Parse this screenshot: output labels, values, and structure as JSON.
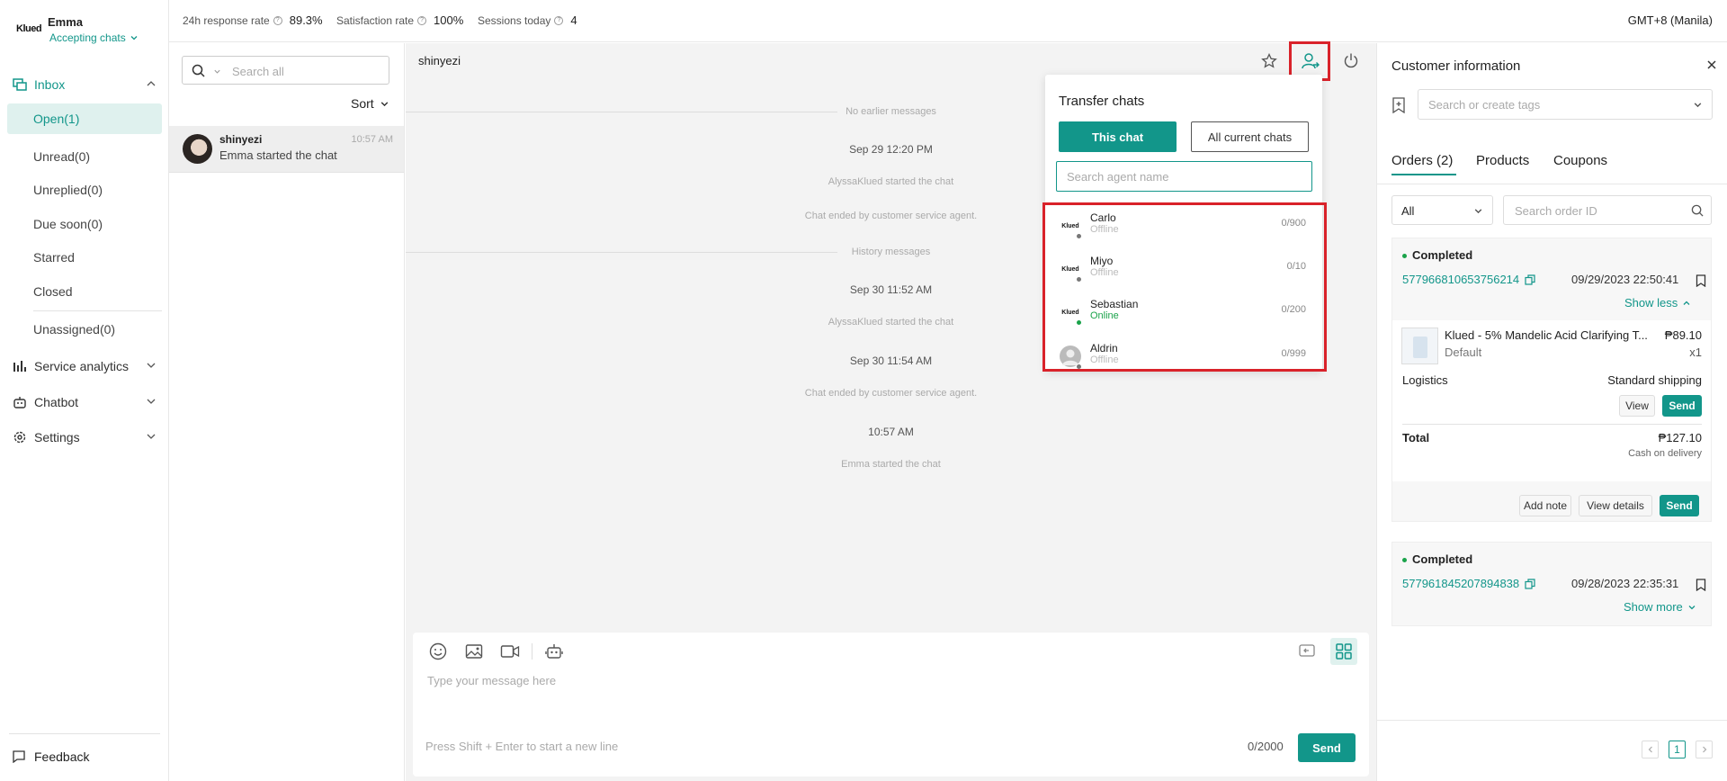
{
  "sidebar": {
    "brand": "Klued",
    "agent_name": "Emma",
    "agent_status": "Accepting chats",
    "inbox_label": "Inbox",
    "items": [
      {
        "label": "Open(1)"
      },
      {
        "label": "Unread(0)"
      },
      {
        "label": "Unreplied(0)"
      },
      {
        "label": "Due soon(0)"
      },
      {
        "label": "Starred"
      },
      {
        "label": "Closed"
      },
      {
        "label": "Unassigned(0)"
      }
    ],
    "groups": [
      {
        "label": "Service analytics"
      },
      {
        "label": "Chatbot"
      },
      {
        "label": "Settings"
      }
    ],
    "feedback": "Feedback"
  },
  "topbar": {
    "response_rate_label": "24h response rate",
    "response_rate_value": "89.3%",
    "satisfaction_label": "Satisfaction rate",
    "satisfaction_value": "100%",
    "sessions_label": "Sessions today",
    "sessions_value": "4",
    "timezone": "GMT+8 (Manila)"
  },
  "convlist": {
    "search_placeholder": "Search all",
    "sort_label": "Sort",
    "conversations": [
      {
        "name": "shinyezi",
        "time": "10:57 AM",
        "preview": "Emma started the chat"
      }
    ]
  },
  "chat": {
    "title": "shinyezi",
    "messages": {
      "no_earlier": "No earlier messages",
      "date1": "Sep 29 12:20 PM",
      "sys1": "AlyssaKlued started the chat",
      "sys2": "Chat ended by customer service agent.",
      "history": "History messages",
      "date2": "Sep 30 11:52 AM",
      "sys3": "AlyssaKlued started the chat",
      "date3": "Sep 30 11:54 AM",
      "sys4": "Chat ended by customer service agent.",
      "date4": "10:57 AM",
      "sys5": "Emma started the chat"
    },
    "composer": {
      "placeholder": "Type your message here",
      "hint": "Press Shift + Enter to start a new line",
      "counter": "0/2000",
      "send": "Send"
    }
  },
  "transfer": {
    "title": "Transfer chats",
    "tab_this": "This chat",
    "tab_all": "All current chats",
    "search_placeholder": "Search agent name",
    "agents": [
      {
        "name": "Carlo",
        "status": "Offline",
        "capacity": "0/900",
        "avatar": "Klued"
      },
      {
        "name": "Miyo",
        "status": "Offline",
        "capacity": "0/10",
        "avatar": "Klued"
      },
      {
        "name": "Sebastian",
        "status": "Online",
        "capacity": "0/200",
        "avatar": "Klued"
      },
      {
        "name": "Aldrin",
        "status": "Offline",
        "capacity": "0/999",
        "avatar": ""
      }
    ]
  },
  "customer": {
    "title": "Customer information",
    "tags_placeholder": "Search or create tags",
    "tabs": [
      "Orders (2)",
      "Products",
      "Coupons"
    ],
    "filter_value": "All",
    "order_search_placeholder": "Search order ID",
    "orders": [
      {
        "status": "Completed",
        "id": "577966810653756214",
        "datetime": "09/29/2023 22:50:41",
        "toggle": "Show less",
        "product": "Klued - 5% Mandelic Acid Clarifying T...",
        "variant": "Default",
        "price": "₱89.10",
        "qty": "x1",
        "logistics_label": "Logistics",
        "logistics_value": "Standard shipping",
        "view": "View",
        "send": "Send",
        "total_label": "Total",
        "total_value": "₱127.10",
        "payment": "Cash on delivery",
        "add_note": "Add note",
        "view_details": "View details",
        "send2": "Send"
      },
      {
        "status": "Completed",
        "id": "577961845207894838",
        "datetime": "09/28/2023 22:35:31",
        "toggle": "Show more"
      }
    ],
    "page": "1"
  },
  "colors": {
    "accent": "#12968a",
    "highlight": "#d9222a",
    "active_bg": "#dff1ee"
  }
}
